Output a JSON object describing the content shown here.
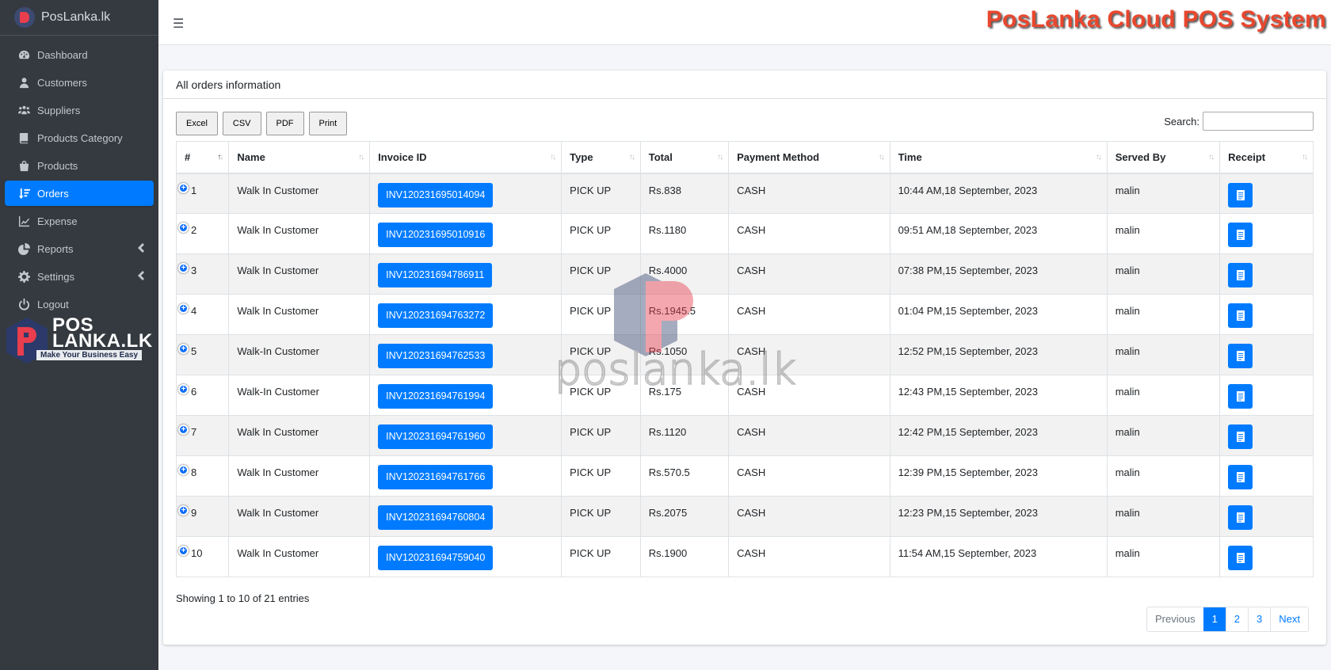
{
  "brand": {
    "name": "PosLanka.lk"
  },
  "sidebar": {
    "items": [
      {
        "label": "Dashboard",
        "icon": "dashboard-icon"
      },
      {
        "label": "Customers",
        "icon": "user-icon"
      },
      {
        "label": "Suppliers",
        "icon": "users-icon"
      },
      {
        "label": "Products Category",
        "icon": "book-icon"
      },
      {
        "label": "Products",
        "icon": "bag-icon"
      },
      {
        "label": "Orders",
        "icon": "orders-icon",
        "active": true
      },
      {
        "label": "Expense",
        "icon": "chart-line-icon"
      },
      {
        "label": "Reports",
        "icon": "pie-chart-icon",
        "expandable": true
      },
      {
        "label": "Settings",
        "icon": "gear-icon",
        "expandable": true
      },
      {
        "label": "Logout",
        "icon": "power-icon"
      }
    ],
    "logo": {
      "line1": "POS",
      "line2": "LANKA.LK",
      "tagline": "Make Your Business Easy"
    }
  },
  "header": {
    "title": "PosLanka Cloud POS System"
  },
  "card": {
    "title": "All orders information"
  },
  "toolbar": {
    "excel": "Excel",
    "csv": "CSV",
    "pdf": "PDF",
    "print": "Print"
  },
  "search": {
    "label": "Search:",
    "value": ""
  },
  "table": {
    "columns": [
      "#",
      "Name",
      "Invoice ID",
      "Type",
      "Total",
      "Payment Method",
      "Time",
      "Served By",
      "Receipt"
    ],
    "rows": [
      {
        "no": "1",
        "name": "Walk In Customer",
        "invoice": "INV120231695014094",
        "type": "PICK UP",
        "total": "Rs.838",
        "payment": "CASH",
        "time": "10:44 AM,18 September, 2023",
        "served": "malin"
      },
      {
        "no": "2",
        "name": "Walk In Customer",
        "invoice": "INV120231695010916",
        "type": "PICK UP",
        "total": "Rs.1180",
        "payment": "CASH",
        "time": "09:51 AM,18 September, 2023",
        "served": "malin"
      },
      {
        "no": "3",
        "name": "Walk In Customer",
        "invoice": "INV120231694786911",
        "type": "PICK UP",
        "total": "Rs.4000",
        "payment": "CASH",
        "time": "07:38 PM,15 September, 2023",
        "served": "malin"
      },
      {
        "no": "4",
        "name": "Walk In Customer",
        "invoice": "INV120231694763272",
        "type": "PICK UP",
        "total": "Rs.1945.5",
        "payment": "CASH",
        "time": "01:04 PM,15 September, 2023",
        "served": "malin"
      },
      {
        "no": "5",
        "name": "Walk-In Customer",
        "invoice": "INV120231694762533",
        "type": "PICK UP",
        "total": "Rs.1050",
        "payment": "CASH",
        "time": "12:52 PM,15 September, 2023",
        "served": "malin"
      },
      {
        "no": "6",
        "name": "Walk-In Customer",
        "invoice": "INV120231694761994",
        "type": "PICK UP",
        "total": "Rs.175",
        "payment": "CASH",
        "time": "12:43 PM,15 September, 2023",
        "served": "malin"
      },
      {
        "no": "7",
        "name": "Walk In Customer",
        "invoice": "INV120231694761960",
        "type": "PICK UP",
        "total": "Rs.1120",
        "payment": "CASH",
        "time": "12:42 PM,15 September, 2023",
        "served": "malin"
      },
      {
        "no": "8",
        "name": "Walk In Customer",
        "invoice": "INV120231694761766",
        "type": "PICK UP",
        "total": "Rs.570.5",
        "payment": "CASH",
        "time": "12:39 PM,15 September, 2023",
        "served": "malin"
      },
      {
        "no": "9",
        "name": "Walk In Customer",
        "invoice": "INV120231694760804",
        "type": "PICK UP",
        "total": "Rs.2075",
        "payment": "CASH",
        "time": "12:23 PM,15 September, 2023",
        "served": "malin"
      },
      {
        "no": "10",
        "name": "Walk In Customer",
        "invoice": "INV120231694759040",
        "type": "PICK UP",
        "total": "Rs.1900",
        "payment": "CASH",
        "time": "11:54 AM,15 September, 2023",
        "served": "malin"
      }
    ]
  },
  "footer": {
    "info": "Showing 1 to 10 of 21 entries",
    "pages": [
      "Previous",
      "1",
      "2",
      "3",
      "Next"
    ],
    "current_page": "1"
  },
  "watermark": {
    "text": "poslanka.lk"
  },
  "colors": {
    "primary": "#007bff",
    "sidebar": "#343a40",
    "title": "#e8472e"
  }
}
